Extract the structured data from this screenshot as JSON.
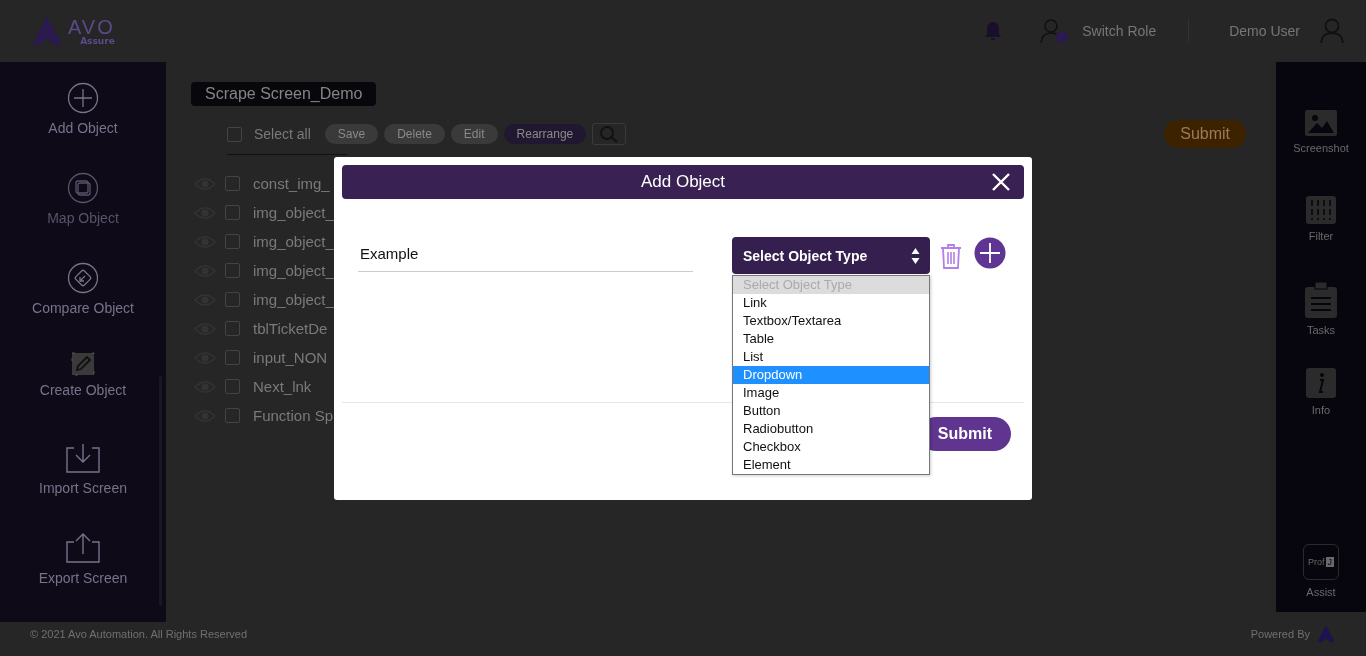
{
  "header": {
    "logo_text": "AVO",
    "logo_subtext": "Assure",
    "switch_role": "Switch Role",
    "user_name": "Demo User"
  },
  "left_sidebar": {
    "items": [
      {
        "label": "Add Object",
        "disabled": false
      },
      {
        "label": "Map Object",
        "disabled": true
      },
      {
        "label": "Compare Object",
        "disabled": false
      },
      {
        "label": "Create Object",
        "disabled": false
      },
      {
        "label": "Import Screen",
        "disabled": false
      },
      {
        "label": "Export Screen",
        "disabled": false
      }
    ]
  },
  "main": {
    "screen_title": "Scrape Screen_Demo",
    "select_all": {
      "label": "Select all",
      "checked": false
    },
    "toolbar_buttons": [
      {
        "label": "Save",
        "kind": "plain"
      },
      {
        "label": "Delete",
        "kind": "plain"
      },
      {
        "label": "Edit",
        "kind": "plain"
      },
      {
        "label": "Rearrange",
        "kind": "accent"
      }
    ],
    "submit": "Submit",
    "objects": [
      {
        "name": "const_img_",
        "checked": false
      },
      {
        "name": "img_object_",
        "checked": false
      },
      {
        "name": "img_object_",
        "checked": false
      },
      {
        "name": "img_object_",
        "checked": false
      },
      {
        "name": "img_object_",
        "checked": false
      },
      {
        "name": "tblTicketDe",
        "checked": false
      },
      {
        "name": "input_NON",
        "checked": false
      },
      {
        "name": "Next_lnk",
        "checked": false
      },
      {
        "name": "Function Sp",
        "checked": false
      }
    ]
  },
  "right_sidebar": {
    "items": [
      {
        "label": "Screenshot"
      },
      {
        "label": "Filter"
      },
      {
        "label": "Tasks"
      },
      {
        "label": "Info"
      }
    ],
    "assist": {
      "label": "Assist",
      "badge_text": "Prof",
      "badge_letter": "J"
    }
  },
  "footer": {
    "copyright": "© 2021 Avo Automation. All Rights Reserved",
    "powered_by": "Powered By"
  },
  "modal": {
    "title": "Add Object",
    "name_value": "Example",
    "object_type": {
      "value": "Select Object Type",
      "open": true,
      "options": [
        {
          "label": "Select Object Type",
          "disabled": true,
          "selected": true,
          "highlighted": false
        },
        {
          "label": "Link",
          "disabled": false,
          "selected": false,
          "highlighted": false
        },
        {
          "label": "Textbox/Textarea",
          "disabled": false,
          "selected": false,
          "highlighted": false
        },
        {
          "label": "Table",
          "disabled": false,
          "selected": false,
          "highlighted": false
        },
        {
          "label": "List",
          "disabled": false,
          "selected": false,
          "highlighted": false
        },
        {
          "label": "Dropdown",
          "disabled": false,
          "selected": false,
          "highlighted": true
        },
        {
          "label": "Image",
          "disabled": false,
          "selected": false,
          "highlighted": false
        },
        {
          "label": "Button",
          "disabled": false,
          "selected": false,
          "highlighted": false
        },
        {
          "label": "Radiobutton",
          "disabled": false,
          "selected": false,
          "highlighted": false
        },
        {
          "label": "Checkbox",
          "disabled": false,
          "selected": false,
          "highlighted": false
        },
        {
          "label": "Element",
          "disabled": false,
          "selected": false,
          "highlighted": false
        }
      ]
    },
    "submit": "Submit"
  }
}
